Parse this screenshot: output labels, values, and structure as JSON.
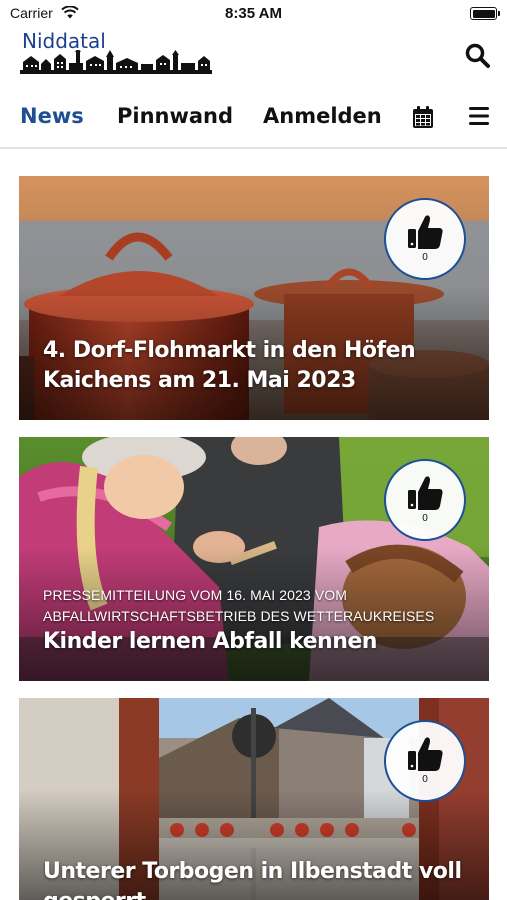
{
  "status_bar": {
    "carrier": "Carrier",
    "time": "8:35 AM"
  },
  "header": {
    "brand": "Niddatal",
    "search_icon": "search-icon",
    "brand_color": "#1c3f8f"
  },
  "nav": {
    "tabs": [
      {
        "label": "News",
        "active": true
      },
      {
        "label": "Pinnwand",
        "active": false
      },
      {
        "label": "Anmelden",
        "active": false
      }
    ],
    "calendar_icon": "calendar-icon",
    "menu_icon": "hamburger-menu-icon",
    "active_color": "#1c4f94"
  },
  "news": [
    {
      "subtitle": "",
      "title": "4. Dorf-Flohmarkt in den Höfen Kaichens am 21. Mai 2023",
      "likes": "0",
      "image": "red enamel cooking pots"
    },
    {
      "subtitle": "PRESSEMITTEILUNG VOM 16. MAI 2023 VOM ABFALLWIRTSCHAFTSBETRIEB DES WETTERAUKREISES",
      "title": "Kinder lernen Abfall kennen",
      "likes": "0",
      "image": "children examining waste outdoors"
    },
    {
      "subtitle": "",
      "title": "Unterer Torbogen in Ilbenstadt voll gesperrt",
      "likes": "0",
      "image": "archway with road closure barriers"
    }
  ]
}
